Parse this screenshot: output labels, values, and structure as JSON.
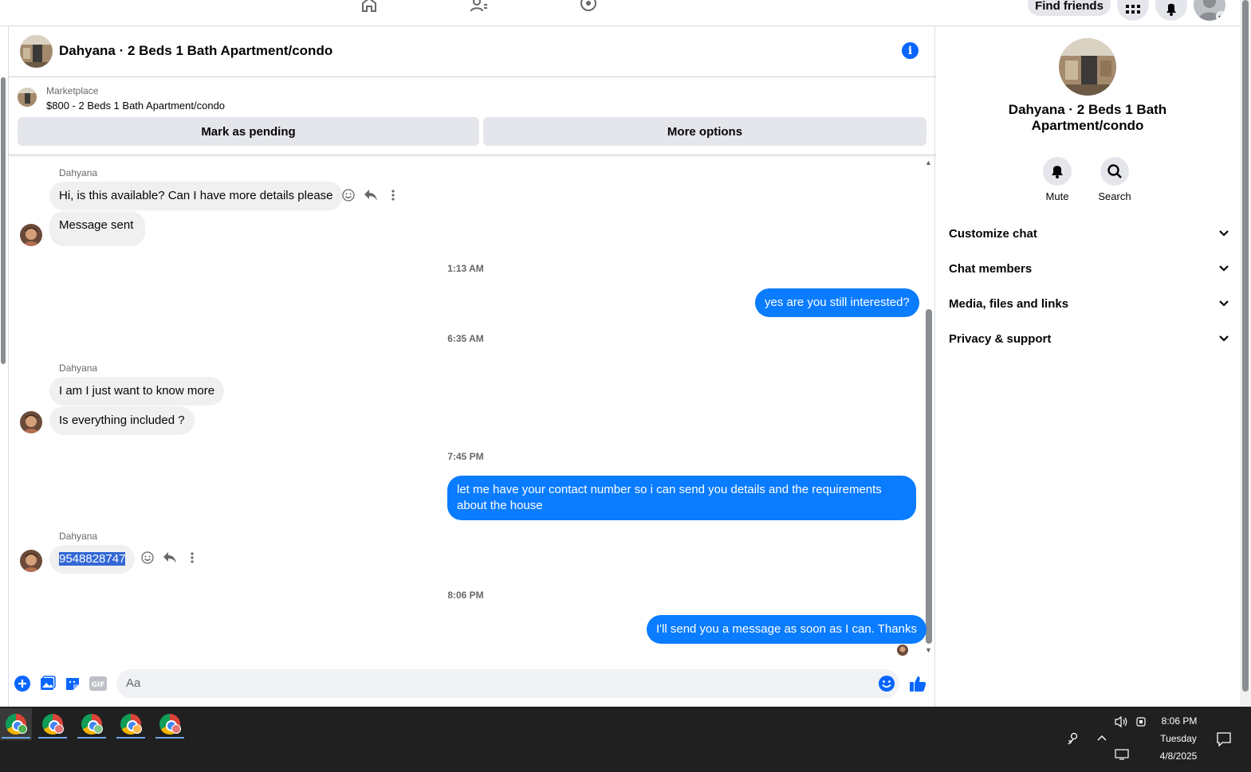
{
  "topnav": {
    "find_friends": "Find friends"
  },
  "chat": {
    "title": "Dahyana · 2 Beds 1 Bath Apartment/condo",
    "marketplace_label": "Marketplace",
    "listing": "$800 - 2 Beds 1 Bath Apartment/condo",
    "mark_pending": "Mark as pending",
    "more_options": "More options",
    "messages": {
      "sender1": "Dahyana",
      "m1": "Hi, is this available? Can I have more details please",
      "m2": "Message sent",
      "ts1": "1:13 AM",
      "m3": "yes are you still interested?",
      "ts2": "6:35 AM",
      "sender2": "Dahyana",
      "m4": "I am I just want to know more",
      "m5": "Is everything included ?",
      "ts3": "7:45 PM",
      "m6": "let me have your contact number so i can send you details and the requirements about the house",
      "sender3": "Dahyana",
      "m7": "9548828747",
      "ts4": "8:06 PM",
      "m8": "I'll send you a message as soon as I can. Thanks"
    },
    "composer_placeholder": "Aa"
  },
  "info_panel": {
    "name": "Dahyana · 2 Beds 1 Bath Apartment/condo",
    "mute": "Mute",
    "search": "Search",
    "sections": [
      "Customize chat",
      "Chat members",
      "Media, files and links",
      "Privacy & support"
    ]
  },
  "taskbar": {
    "time": "8:06 PM",
    "day": "Tuesday",
    "date": "4/8/2025"
  },
  "colors": {
    "accent": "#0866ff",
    "outgoing_bubble": "#0a7cff",
    "incoming_bubble": "#f0f0f0"
  }
}
